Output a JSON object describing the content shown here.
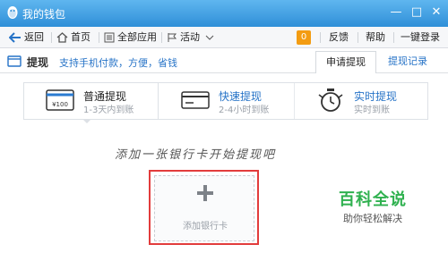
{
  "window": {
    "title": "我的钱包",
    "min_symbol": "—",
    "max_symbol": "□",
    "close_symbol": "✕"
  },
  "toolbar": {
    "back": "返回",
    "home": "首页",
    "all_apps": "全部应用",
    "activities": "活动",
    "badge_count": "0",
    "feedback": "反馈",
    "help": "帮助",
    "login": "一键登录"
  },
  "section": {
    "title": "提现",
    "description": "支持手机付款，方便，省钱",
    "tabs": [
      {
        "label": "申请提现",
        "active": true
      },
      {
        "label": "提现记录",
        "active": false
      }
    ]
  },
  "methods": [
    {
      "title": "普通提现",
      "subtitle": "1-3天内到账",
      "icon": "card-100-icon",
      "active": true,
      "icon_text": "¥100"
    },
    {
      "title": "快速提现",
      "subtitle": "2-4小时到账",
      "icon": "card-icon",
      "active": false
    },
    {
      "title": "实时提现",
      "subtitle": "实时到账",
      "icon": "stopwatch-icon",
      "active": false
    }
  ],
  "hint": "添加一张银行卡开始提现吧",
  "add_card": {
    "label": "添加银行卡"
  },
  "watermark": {
    "title": "百科全说",
    "subtitle": "助你轻松解决"
  },
  "colors": {
    "titlebar": "#3a9be3",
    "link": "#2673c7",
    "highlight_border": "#e23c3c",
    "brand_green": "#2fb14f",
    "badge": "#f39c12"
  }
}
